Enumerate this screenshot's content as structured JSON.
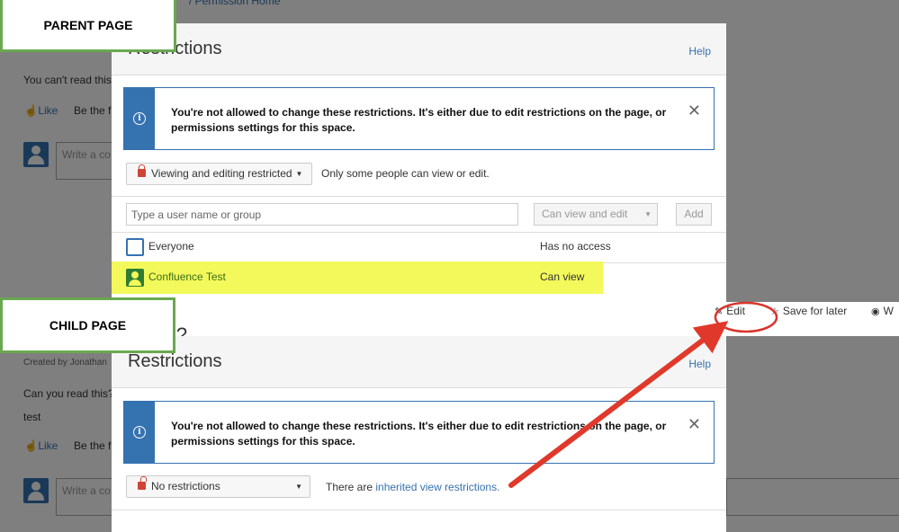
{
  "colors": {
    "accent": "#3572b0",
    "highlight": "#f3f95a",
    "arrow": "#e0392b",
    "label_border": "#6aa84f"
  },
  "labels": {
    "parent": "PARENT PAGE",
    "child": "CHILD PAGE"
  },
  "parent": {
    "background": {
      "breadcrumb_fragment": "/ Permission Home",
      "body_text": "You can't read this",
      "like": "Like",
      "be_first": "Be the fir",
      "comment_placeholder": "Write a co"
    },
    "dialog": {
      "title": "Restrictions",
      "help": "Help",
      "info_message": "You're not allowed to change these restrictions. It's either due to edit restrictions on the page, or permissions settings for this space.",
      "restriction_dropdown": "Viewing and editing restricted",
      "restriction_description": "Only some people can view or edit.",
      "user_input_placeholder": "Type a user name or group",
      "permission_select": "Can view and edit",
      "add_button": "Add",
      "entries": [
        {
          "name": "Everyone",
          "permission": "Has no access"
        },
        {
          "name": "Confluence Test",
          "permission": "Can view"
        }
      ]
    }
  },
  "child": {
    "background": {
      "title_fragment": "is?",
      "created_by": "Created by Jonathan",
      "body_text": "Can you read this?",
      "body_text2": "test",
      "like": "Like",
      "be_first": "Be the fir",
      "comment_placeholder": "Write a co"
    },
    "actions": {
      "edit": "Edit",
      "save_for_later": "Save for later",
      "watch": "W"
    },
    "dialog": {
      "title": "Restrictions",
      "help": "Help",
      "info_message": "You're not allowed to change these restrictions. It's either due to edit restrictions on the page, or permissions settings for this space.",
      "restriction_dropdown": "No restrictions",
      "description_prefix": "There are ",
      "description_link": "inherited view restrictions."
    }
  }
}
